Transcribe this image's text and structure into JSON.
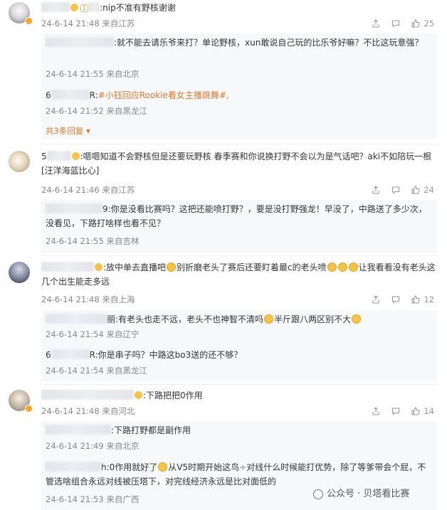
{
  "comments": [
    {
      "text": ":nip不准有野核谢谢",
      "level": "1",
      "date": "24-6-14 21:48",
      "location": "来自江苏",
      "likes": "25",
      "replies": [
        {
          "text": ":就不能去请乐爷来打？单论野核，xun敢说自己玩的比乐爷好嘛？不比这玩意强？",
          "date": "24-6-14 21:55",
          "location": "来自北京"
        },
        {
          "prefix": "6",
          "mid": "R:",
          "topic": "#小钰回应Rookie看女主播跳舞#,",
          "date": "24-6-14 21:52",
          "location": "来自黑龙江"
        }
      ],
      "more": "共3条回复"
    },
    {
      "prefix": "5",
      "text": ":嗯嗯知道不会野核但是还要玩野核 春季赛和你说换打野不会以为是气话吧？aki不如陪玩一根[汪洋海蓝比心]",
      "date": "24-6-14 21:46",
      "location": "来自江苏",
      "likes": "24",
      "replies": [
        {
          "mid": "9:",
          "text": "你是没看比赛吗？这把还能喷打野？，要是没打野强龙！早没了，中路送了多少次，没看见，下路打啥样也看不见？",
          "date": "24-6-14 21:55",
          "location": "来自吉林"
        }
      ]
    },
    {
      "text1": ":放中单去直播吧",
      "text2": "别折磨老头了赛后还要盯着最c的老头喷",
      "text3": "让我看看没有老头这几个出生能走多远",
      "date": "24-6-14 21:48",
      "location": "来自上海",
      "likes": "12",
      "replies": [
        {
          "mid": "丽",
          "text1": ":有老头也走不远，老头不也神智不清吗",
          "text2": "半斤跟八两区别不大",
          "date": "24-6-14 21:54",
          "location": "来自辽宁"
        },
        {
          "prefix": "6",
          "mid": "R:",
          "text": "你是串子吗？中路这bo3送的还不够？",
          "date": "24-6-14 21:54",
          "location": "来自黑龙江"
        }
      ]
    },
    {
      "text": ":下路把把0作用",
      "date": "24-6-14 21:48",
      "location": "来自河北",
      "likes": "14",
      "replies": [
        {
          "text": ":下路打野都是副作用",
          "date": "24-6-14 21:49",
          "location": "来自北京"
        },
        {
          "mid": "h:",
          "text1": "0作用就好了",
          "text2": "从V5时期开始这鸟",
          "text3": "对线什么时候能打优势，除了等爹带会个屁，不管选啥组合永远对线被压塔下，对完线经济永远是比对面低的",
          "date": "24-6-14 21:53",
          "location": "来自广西"
        }
      ]
    }
  ],
  "watermark": "公众号 · 贝塔看比赛",
  "icons": [
    "share-icon",
    "comment-icon",
    "like-icon",
    "vip-crown-icon",
    "chevron-down-icon"
  ]
}
